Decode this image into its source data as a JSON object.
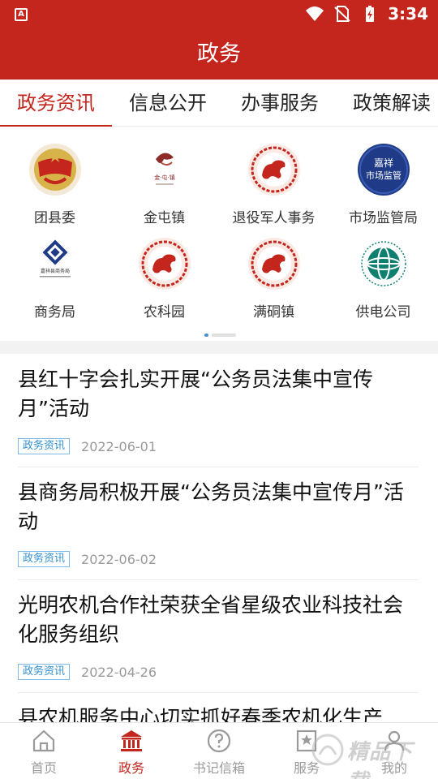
{
  "status_bar": {
    "time": "3:34"
  },
  "header": {
    "title": "政务"
  },
  "tabs": [
    {
      "label": "政务资讯",
      "active": true
    },
    {
      "label": "信息公开",
      "active": false
    },
    {
      "label": "办事服务",
      "active": false
    },
    {
      "label": "政策解读",
      "active": false
    }
  ],
  "grid": [
    {
      "label": "团县委",
      "icon": "youth-league-badge-icon"
    },
    {
      "label": "金屯镇",
      "icon": "jintun-town-logo-icon"
    },
    {
      "label": "退役军人事务",
      "icon": "qilin-seal-icon"
    },
    {
      "label": "市场监管局",
      "icon": "market-supervision-logo-icon"
    },
    {
      "label": "商务局",
      "icon": "commerce-bureau-logo-icon"
    },
    {
      "label": "农科园",
      "icon": "qilin-seal-icon"
    },
    {
      "label": "满硐镇",
      "icon": "qilin-seal-icon"
    },
    {
      "label": "供电公司",
      "icon": "state-grid-logo-icon"
    }
  ],
  "grid_logo_text": {
    "market_line1": "嘉祥",
    "market_line2": "市场监管",
    "commerce": "嘉祥县商务局",
    "jintun": "金·屯·镇"
  },
  "carousel": {
    "pages": 2,
    "current": 1
  },
  "news": [
    {
      "title": "县红十字会扎实开展“公务员法集中宣传月”活动",
      "tag": "政务资讯",
      "date": "2022-06-01"
    },
    {
      "title": "县商务局积极开展“公务员法集中宣传月”活动",
      "tag": "政务资讯",
      "date": "2022-06-02"
    },
    {
      "title": "光明农机合作社荣获全省星级农业科技社会化服务组织",
      "tag": "政务资讯",
      "date": "2022-04-26"
    },
    {
      "title": "县农机服务中心切实抓好春季农机化生产",
      "tag": "",
      "date": ""
    }
  ],
  "bottom_nav": [
    {
      "label": "首页",
      "icon": "home-icon",
      "active": false
    },
    {
      "label": "政务",
      "icon": "government-building-icon",
      "active": true
    },
    {
      "label": "书记信箱",
      "icon": "question-circle-icon",
      "active": false
    },
    {
      "label": "服务",
      "icon": "star-bookmark-icon",
      "active": false
    },
    {
      "label": "我的",
      "icon": "person-icon",
      "active": false
    }
  ],
  "watermark": {
    "text": "精品下载"
  },
  "colors": {
    "brand": "#c4261e",
    "tag_blue": "#2f8fd0",
    "inactive": "#9a9a9a"
  }
}
